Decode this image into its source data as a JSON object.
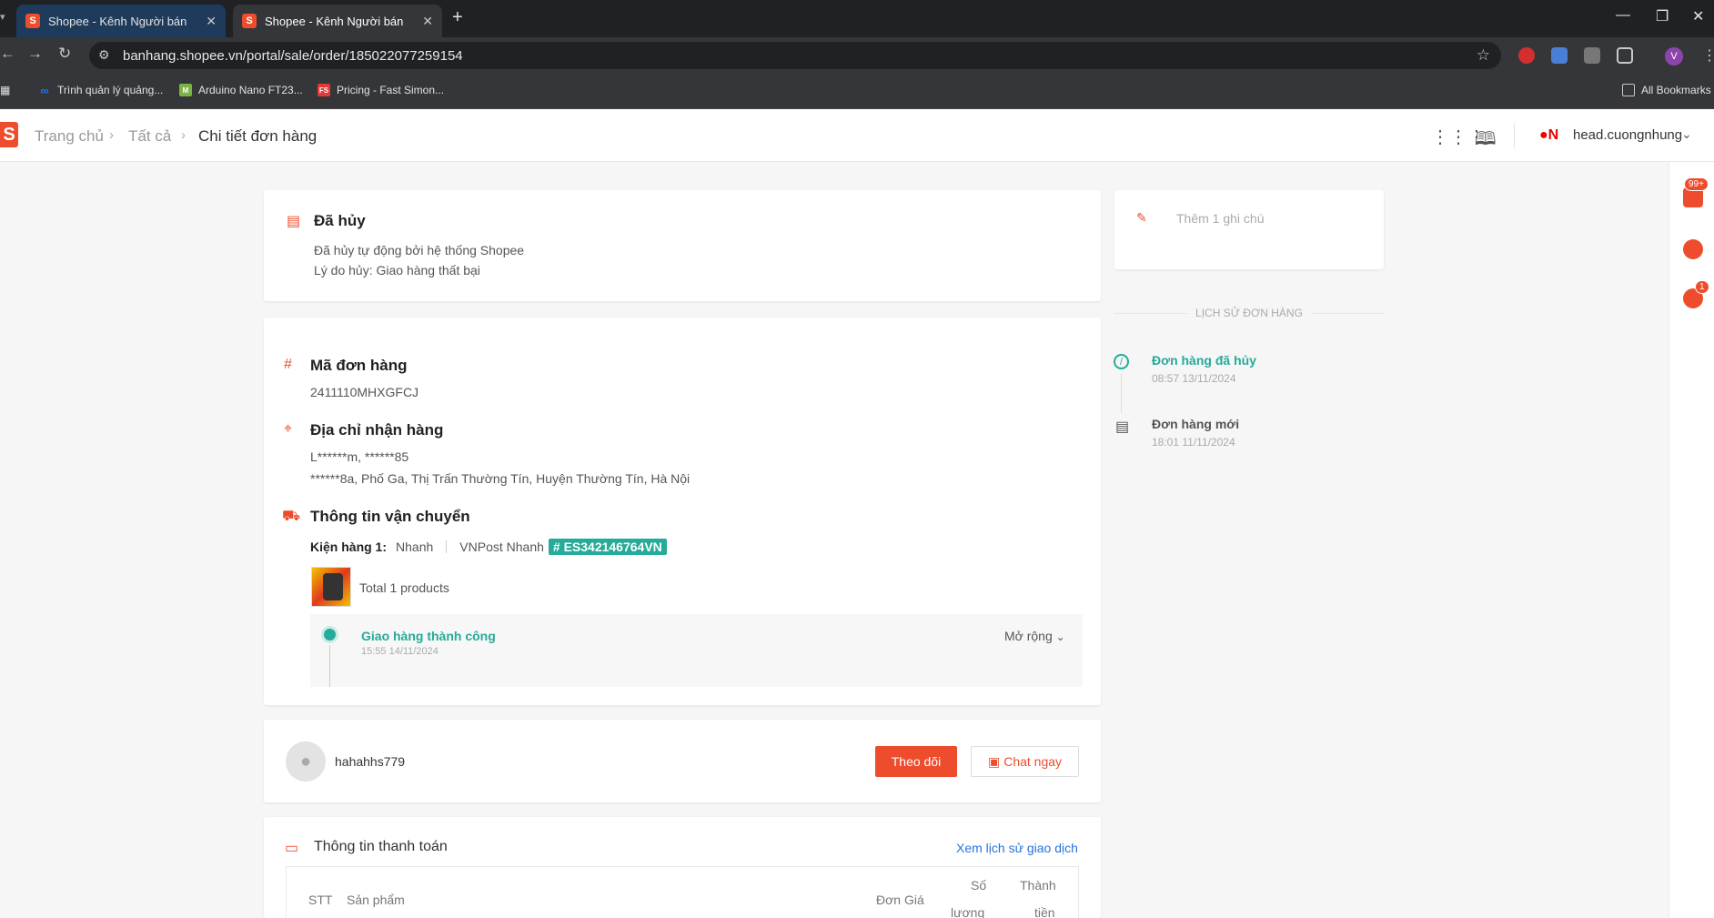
{
  "browser": {
    "tabs": [
      {
        "title": "Shopee - Kênh Người bán",
        "active": false
      },
      {
        "title": "Shopee - Kênh Người bán",
        "active": true
      }
    ],
    "url": "banhang.shopee.vn/portal/sale/order/185022077259154",
    "bookmarks": [
      {
        "label": "Trình quản lý quảng..."
      },
      {
        "label": "Arduino Nano FT23..."
      },
      {
        "label": "Pricing - Fast Simon..."
      }
    ],
    "all_bookmarks": "All Bookmarks",
    "profile_initial": "V"
  },
  "header": {
    "breadcrumb": [
      "Trang chủ",
      "Tất cả",
      "Chi tiết đơn hàng"
    ],
    "shop_name": "head.cuongnhung"
  },
  "status_card": {
    "title": "Đã hủy",
    "line1": "Đã hủy tự động bởi hệ thống Shopee",
    "line2": "Lý do hủy: Giao hàng thất bại"
  },
  "order": {
    "id_label": "Mã đơn hàng",
    "id_value": "2411110MHXGFCJ",
    "address_label": "Địa chỉ nhận hàng",
    "address_name": "L******m, ******85",
    "address_line": "******8a, Phố Ga, Thị Trấn Thường Tín, Huyện Thường Tín, Hà Nội",
    "shipping_label": "Thông tin vận chuyển",
    "package_label": "Kiện hàng 1:",
    "ship_speed": "Nhanh",
    "carrier": "VNPost Nhanh",
    "tracking": "# ES342146764VN",
    "total_products": "Total 1 products",
    "track_status": "Giao hàng thành công",
    "track_time": "15:55 14/11/2024",
    "expand": "Mở rộng"
  },
  "buyer": {
    "username": "hahahhs779",
    "follow": "Theo dõi",
    "chat": "Chat ngay"
  },
  "payment": {
    "title": "Thông tin thanh toán",
    "history_link": "Xem lịch sử giao dịch",
    "cols": {
      "stt": "STT",
      "product": "Sản phẩm",
      "price": "Đơn Giá",
      "qty_1": "Số",
      "qty_2": "lượng",
      "total_1": "Thành",
      "total_2": "tiền"
    }
  },
  "note": {
    "placeholder": "Thêm 1 ghi chú"
  },
  "history": {
    "title": "LỊCH SỬ ĐƠN HÀNG",
    "events": [
      {
        "title": "Đơn hàng đã hủy",
        "time": "08:57 13/11/2024"
      },
      {
        "title": "Đơn hàng mới",
        "time": "18:01 11/11/2024"
      }
    ]
  },
  "rail": {
    "notif_badge": "99+",
    "chat_badge": "1"
  },
  "colors": {
    "brand": "#ee4d2d",
    "teal": "#26aa99"
  }
}
